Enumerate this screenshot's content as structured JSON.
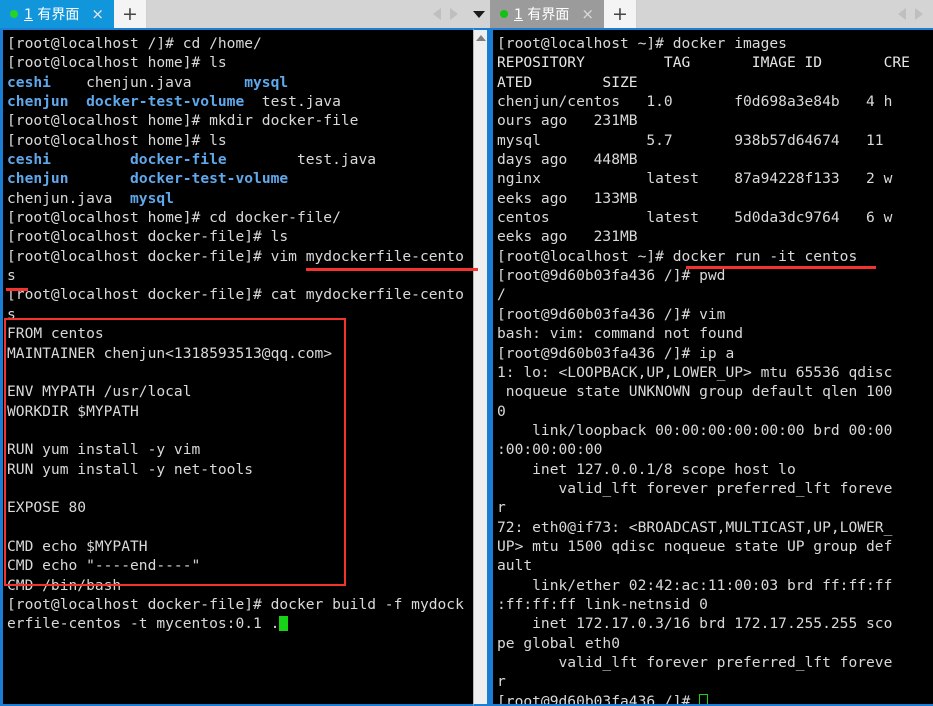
{
  "window": {
    "title": "Terminal emulator with two SSH session panes",
    "accent_blue": "#1296db",
    "pane_border_blue": "#1a7fd4",
    "annotation_red": "#f4332e",
    "terminal_bg": "#000000",
    "terminal_fg": "#d8d8d8",
    "terminal_dir_blue": "#5fa8ec",
    "cursor_green": "#16d316"
  },
  "left_pane": {
    "tab": {
      "status_dot": "connected-dot",
      "number": "1",
      "label": "有界面",
      "close_label": "×",
      "state": "active"
    },
    "new_tab_label": "+",
    "nav": {
      "prev_icon": "chevron-left-icon",
      "next_icon": "chevron-right-icon"
    },
    "dropdown_icon": "chevron-down-icon",
    "scrollbar": {
      "up_arrow_icon": "scroll-up-arrow-icon"
    },
    "terminal_lines": [
      {
        "segs": [
          {
            "t": "[root@localhost /]# cd /home/",
            "c": "w"
          }
        ]
      },
      {
        "segs": [
          {
            "t": "[root@localhost home]# ls",
            "c": "w"
          }
        ]
      },
      {
        "segs": [
          {
            "t": "ceshi",
            "c": "b"
          },
          {
            "t": "    chenjun.java      ",
            "c": "w"
          },
          {
            "t": "mysql",
            "c": "b"
          }
        ]
      },
      {
        "segs": [
          {
            "t": "chenjun  docker-test-volume",
            "c": "b"
          },
          {
            "t": "  test.java",
            "c": "w"
          }
        ]
      },
      {
        "segs": [
          {
            "t": "[root@localhost home]# mkdir docker-file",
            "c": "w"
          }
        ]
      },
      {
        "segs": [
          {
            "t": "[root@localhost home]# ls",
            "c": "w"
          }
        ]
      },
      {
        "segs": [
          {
            "t": "ceshi",
            "c": "b"
          },
          {
            "t": "         ",
            "c": "w"
          },
          {
            "t": "docker-file",
            "c": "b"
          },
          {
            "t": "        test.java",
            "c": "w"
          }
        ]
      },
      {
        "segs": [
          {
            "t": "chenjun",
            "c": "b"
          },
          {
            "t": "       ",
            "c": "w"
          },
          {
            "t": "docker-test-volume",
            "c": "b"
          }
        ]
      },
      {
        "segs": [
          {
            "t": "chenjun.java  ",
            "c": "w"
          },
          {
            "t": "mysql",
            "c": "b"
          }
        ]
      },
      {
        "segs": [
          {
            "t": "[root@localhost home]# cd docker-file/",
            "c": "w"
          }
        ]
      },
      {
        "segs": [
          {
            "t": "[root@localhost docker-file]# ls",
            "c": "w"
          }
        ]
      },
      {
        "segs": [
          {
            "t": "[root@localhost docker-file]# vim mydockerfile-cento",
            "c": "w"
          }
        ]
      },
      {
        "segs": [
          {
            "t": "s",
            "c": "w"
          }
        ]
      },
      {
        "segs": [
          {
            "t": "[root@localhost docker-file]# cat mydockerfile-cento",
            "c": "w"
          }
        ]
      },
      {
        "segs": [
          {
            "t": "s",
            "c": "w"
          }
        ]
      },
      {
        "segs": [
          {
            "t": "FROM centos",
            "c": "w"
          }
        ]
      },
      {
        "segs": [
          {
            "t": "MAINTAINER chenjun<1318593513@qq.com>",
            "c": "w"
          }
        ]
      },
      {
        "segs": [
          {
            "t": "",
            "c": "w"
          }
        ]
      },
      {
        "segs": [
          {
            "t": "ENV MYPATH /usr/local",
            "c": "w"
          }
        ]
      },
      {
        "segs": [
          {
            "t": "WORKDIR $MYPATH",
            "c": "w"
          }
        ]
      },
      {
        "segs": [
          {
            "t": "",
            "c": "w"
          }
        ]
      },
      {
        "segs": [
          {
            "t": "RUN yum install -y vim",
            "c": "w"
          }
        ]
      },
      {
        "segs": [
          {
            "t": "RUN yum install -y net-tools",
            "c": "w"
          }
        ]
      },
      {
        "segs": [
          {
            "t": "",
            "c": "w"
          }
        ]
      },
      {
        "segs": [
          {
            "t": "EXPOSE 80",
            "c": "w"
          }
        ]
      },
      {
        "segs": [
          {
            "t": "",
            "c": "w"
          }
        ]
      },
      {
        "segs": [
          {
            "t": "CMD echo $MYPATH",
            "c": "w"
          }
        ]
      },
      {
        "segs": [
          {
            "t": "CMD echo \"----end----\"",
            "c": "w"
          }
        ]
      },
      {
        "segs": [
          {
            "t": "CMD /bin/bash",
            "c": "w"
          }
        ]
      },
      {
        "segs": [
          {
            "t": "[root@localhost docker-file]# docker build -f mydock",
            "c": "w"
          }
        ]
      },
      {
        "segs": [
          {
            "t": "erfile-centos -t mycentos:0.1 .",
            "c": "w"
          }
        ],
        "cursor": "block"
      }
    ],
    "annotations": [
      {
        "kind": "underline",
        "target": "mydockerfile-centos command underline part 1"
      },
      {
        "kind": "underline",
        "target": "mydockerfile-centos command underline part 2"
      },
      {
        "kind": "box",
        "target": "dockerfile-content-box"
      }
    ]
  },
  "right_pane": {
    "tab": {
      "status_dot": "connected-dot",
      "number": "1",
      "label": "有界面",
      "close_label": "×",
      "state": "inactive"
    },
    "new_tab_label": "+",
    "nav": {
      "prev_icon": "chevron-left-icon",
      "next_icon": "chevron-right-icon"
    },
    "terminal_lines": [
      {
        "segs": [
          {
            "t": "[root@localhost ~]# docker images",
            "c": "w"
          }
        ]
      },
      {
        "segs": [
          {
            "t": "REPOSITORY         TAG       IMAGE ID       CRE",
            "c": "h"
          }
        ]
      },
      {
        "segs": [
          {
            "t": "ATED        SIZE",
            "c": "h"
          }
        ]
      },
      {
        "segs": [
          {
            "t": "chenjun/centos   1.0       f0d698a3e84b   4 h",
            "c": "w"
          }
        ]
      },
      {
        "segs": [
          {
            "t": "ours ago   231MB",
            "c": "w"
          }
        ]
      },
      {
        "segs": [
          {
            "t": "mysql            5.7       938b57d64674   11",
            "c": "w"
          }
        ]
      },
      {
        "segs": [
          {
            "t": "days ago   448MB",
            "c": "w"
          }
        ]
      },
      {
        "segs": [
          {
            "t": "nginx            latest    87a94228f133   2 w",
            "c": "w"
          }
        ]
      },
      {
        "segs": [
          {
            "t": "eeks ago   133MB",
            "c": "w"
          }
        ]
      },
      {
        "segs": [
          {
            "t": "centos           latest    5d0da3dc9764   6 w",
            "c": "w"
          }
        ]
      },
      {
        "segs": [
          {
            "t": "eeks ago   231MB",
            "c": "w"
          }
        ]
      },
      {
        "segs": [
          {
            "t": "[root@localhost ~]# docker run -it centos",
            "c": "w"
          }
        ]
      },
      {
        "segs": [
          {
            "t": "[root@9d60b03fa436 /]# pwd",
            "c": "w"
          }
        ]
      },
      {
        "segs": [
          {
            "t": "/",
            "c": "w"
          }
        ]
      },
      {
        "segs": [
          {
            "t": "[root@9d60b03fa436 /]# vim",
            "c": "w"
          }
        ]
      },
      {
        "segs": [
          {
            "t": "bash: vim: command not found",
            "c": "w"
          }
        ]
      },
      {
        "segs": [
          {
            "t": "[root@9d60b03fa436 /]# ip a",
            "c": "w"
          }
        ]
      },
      {
        "segs": [
          {
            "t": "1: lo: <LOOPBACK,UP,LOWER_UP> mtu 65536 qdisc",
            "c": "w"
          }
        ]
      },
      {
        "segs": [
          {
            "t": " noqueue state UNKNOWN group default qlen 100",
            "c": "w"
          }
        ]
      },
      {
        "segs": [
          {
            "t": "0",
            "c": "w"
          }
        ]
      },
      {
        "segs": [
          {
            "t": "    link/loopback 00:00:00:00:00:00 brd 00:00",
            "c": "w"
          }
        ]
      },
      {
        "segs": [
          {
            "t": ":00:00:00:00",
            "c": "w"
          }
        ]
      },
      {
        "segs": [
          {
            "t": "    inet 127.0.0.1/8 scope host lo",
            "c": "w"
          }
        ]
      },
      {
        "segs": [
          {
            "t": "       valid_lft forever preferred_lft foreve",
            "c": "w"
          }
        ]
      },
      {
        "segs": [
          {
            "t": "r",
            "c": "w"
          }
        ]
      },
      {
        "segs": [
          {
            "t": "72: eth0@if73: <BROADCAST,MULTICAST,UP,LOWER_",
            "c": "w"
          }
        ]
      },
      {
        "segs": [
          {
            "t": "UP> mtu 1500 qdisc noqueue state UP group def",
            "c": "w"
          }
        ]
      },
      {
        "segs": [
          {
            "t": "ault",
            "c": "w"
          }
        ]
      },
      {
        "segs": [
          {
            "t": "    link/ether 02:42:ac:11:00:03 brd ff:ff:ff",
            "c": "w"
          }
        ]
      },
      {
        "segs": [
          {
            "t": ":ff:ff:ff link-netnsid 0",
            "c": "w"
          }
        ]
      },
      {
        "segs": [
          {
            "t": "    inet 172.17.0.3/16 brd 172.17.255.255 sco",
            "c": "w"
          }
        ]
      },
      {
        "segs": [
          {
            "t": "pe global eth0",
            "c": "w"
          }
        ]
      },
      {
        "segs": [
          {
            "t": "       valid_lft forever preferred_lft foreve",
            "c": "w"
          }
        ]
      },
      {
        "segs": [
          {
            "t": "r",
            "c": "w"
          }
        ]
      },
      {
        "segs": [
          {
            "t": "[root@9d60b03fa436 /]# ",
            "c": "w"
          }
        ],
        "cursor": "hollow"
      }
    ],
    "annotations": [
      {
        "kind": "underline",
        "target": "docker-run-it-centos-underline"
      }
    ]
  }
}
